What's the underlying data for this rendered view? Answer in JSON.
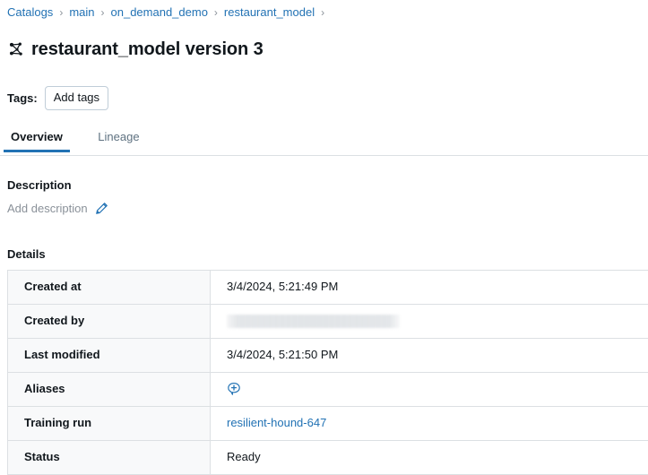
{
  "breadcrumb": {
    "separator": "›",
    "items": [
      {
        "label": "Catalogs"
      },
      {
        "label": "main"
      },
      {
        "label": "on_demand_demo"
      },
      {
        "label": "restaurant_model"
      }
    ],
    "trailing_separator": "›"
  },
  "header": {
    "icon": "model-graph-icon",
    "title": "restaurant_model version 3"
  },
  "tags": {
    "label": "Tags:",
    "add_button": "Add tags"
  },
  "tabs": [
    {
      "label": "Overview",
      "active": true
    },
    {
      "label": "Lineage",
      "active": false
    }
  ],
  "description": {
    "heading": "Description",
    "placeholder": "Add description",
    "edit_icon": "pencil-icon"
  },
  "details": {
    "heading": "Details",
    "rows": [
      {
        "label": "Created at",
        "value": "3/4/2024, 5:21:49 PM",
        "type": "text"
      },
      {
        "label": "Created by",
        "value": "",
        "type": "redacted"
      },
      {
        "label": "Last modified",
        "value": "3/4/2024, 5:21:50 PM",
        "type": "text"
      },
      {
        "label": "Aliases",
        "value": "",
        "type": "icon",
        "icon": "add-alias-icon"
      },
      {
        "label": "Training run",
        "value": "resilient-hound-647",
        "type": "link"
      },
      {
        "label": "Status",
        "value": "Ready",
        "type": "text"
      }
    ]
  },
  "colors": {
    "link": "#2272B4",
    "accent": "#2272B4",
    "border": "#DCE0E3",
    "label_bg": "#F8F9FA",
    "muted_text": "#8A9199",
    "text": "#11171C"
  }
}
